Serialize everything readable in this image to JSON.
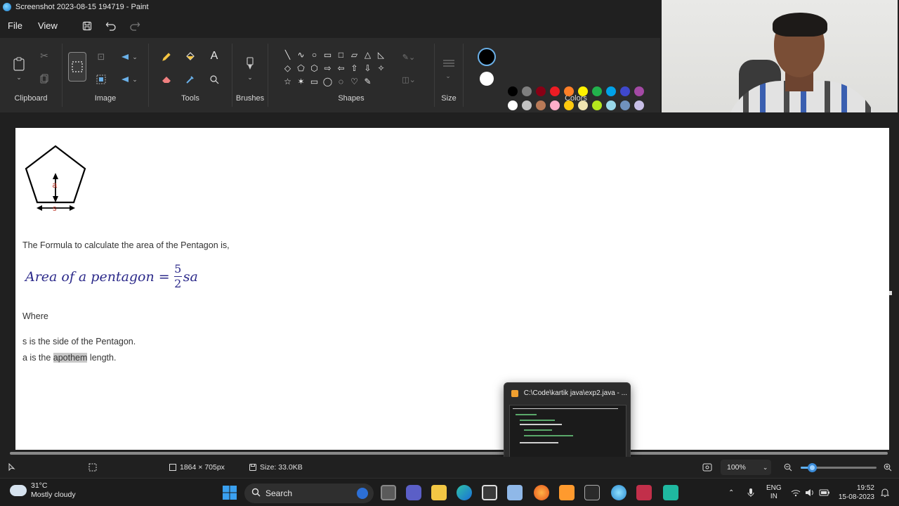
{
  "window": {
    "title": "Screenshot 2023-08-15 194719 - Paint"
  },
  "menu": {
    "file": "File",
    "view": "View"
  },
  "ribbon": {
    "groups": {
      "clipboard": "Clipboard",
      "image": "Image",
      "tools": "Tools",
      "brushes": "Brushes",
      "shapes": "Shapes",
      "size": "Size",
      "colors": "Colors"
    },
    "shapes": [
      "╲",
      "∿",
      "○",
      "▭",
      "□",
      "▱",
      "△",
      "◺",
      "◇",
      "⬠",
      "⬡",
      "⇨",
      "⇦",
      "⇧",
      "⇩",
      "✧",
      "☆",
      "✶",
      "▭",
      "◯",
      "◌",
      "♡",
      "✎",
      ""
    ],
    "palette_row1": [
      "#000000",
      "#7f7f7f",
      "#880015",
      "#ed1c24",
      "#ff7f27",
      "#fff200",
      "#22b14c",
      "#00a2e8",
      "#3f48cc",
      "#a349a4"
    ],
    "palette_row2": [
      "#ffffff",
      "#c3c3c3",
      "#b97a57",
      "#ffaec9",
      "#ffc90e",
      "#efe4b0",
      "#b5e61d",
      "#99d9ea",
      "#7092be",
      "#c8bfe7"
    ],
    "primary_color": "#000000",
    "secondary_color": "#ffffff"
  },
  "canvas": {
    "diagram": {
      "apothem_label": "a",
      "side_label": "s"
    },
    "intro": "The Formula to calculate the area of the Pentagon is,",
    "formula_lhs": "Area of a pentagon =",
    "formula_num": "5",
    "formula_den": "2",
    "formula_rhs": "sa",
    "where": "Where",
    "line_s": "s is the side of the Pentagon.",
    "line_a_pre": "a is the ",
    "line_a_highlight": "apothem",
    "line_a_post": " length."
  },
  "preview": {
    "title": "C:\\Code\\kartik java\\exp2.java - ..."
  },
  "status": {
    "dimensions": "1864 × 705px",
    "size": "Size: 33.0KB",
    "zoom": "100%",
    "zoom_fraction": 0.14
  },
  "taskbar": {
    "weather_temp": "31°C",
    "weather_desc": "Mostly cloudy",
    "search": "Search",
    "lang1": "ENG",
    "lang2": "IN",
    "time": "19:52",
    "date": "15-08-2023"
  }
}
